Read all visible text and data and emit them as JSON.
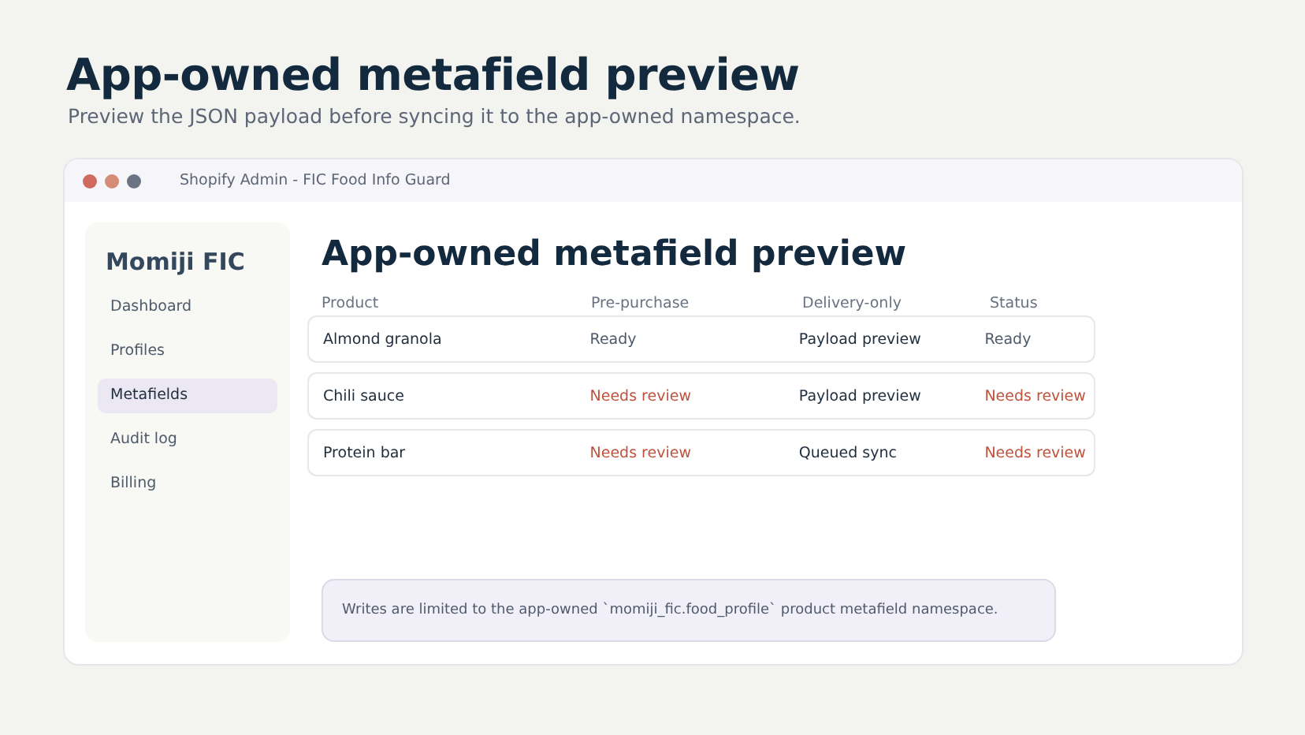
{
  "page": {
    "title": "App-owned metafield preview",
    "subtitle": "Preview the JSON payload before syncing it to the app-owned namespace."
  },
  "window": {
    "title": "Shopify Admin - FIC Food Info Guard"
  },
  "sidebar": {
    "brand": "Momiji FIC",
    "items": [
      {
        "label": "Dashboard",
        "selected": false
      },
      {
        "label": "Profiles",
        "selected": false
      },
      {
        "label": "Metafields",
        "selected": true
      },
      {
        "label": "Audit log",
        "selected": false
      },
      {
        "label": "Billing",
        "selected": false
      }
    ]
  },
  "main": {
    "heading": "App-owned metafield preview",
    "table": {
      "columns": [
        "Product",
        "Pre-purchase",
        "Delivery-only",
        "Status"
      ],
      "rows": [
        {
          "cells": [
            {
              "text": "Almond granola",
              "kind": "plain"
            },
            {
              "text": "Ready",
              "kind": "ok"
            },
            {
              "text": "Payload preview",
              "kind": "plain"
            },
            {
              "text": "Ready",
              "kind": "ok"
            }
          ]
        },
        {
          "cells": [
            {
              "text": "Chili sauce",
              "kind": "plain"
            },
            {
              "text": "Needs review",
              "kind": "warn"
            },
            {
              "text": "Payload preview",
              "kind": "plain"
            },
            {
              "text": "Needs review",
              "kind": "warn"
            }
          ]
        },
        {
          "cells": [
            {
              "text": "Protein bar",
              "kind": "plain"
            },
            {
              "text": "Needs review",
              "kind": "warn"
            },
            {
              "text": "Queued sync",
              "kind": "plain"
            },
            {
              "text": "Needs review",
              "kind": "warn"
            }
          ]
        }
      ]
    },
    "notice": "Writes are limited to the app-owned `momiji_fic.food_profile` product metafield namespace."
  }
}
